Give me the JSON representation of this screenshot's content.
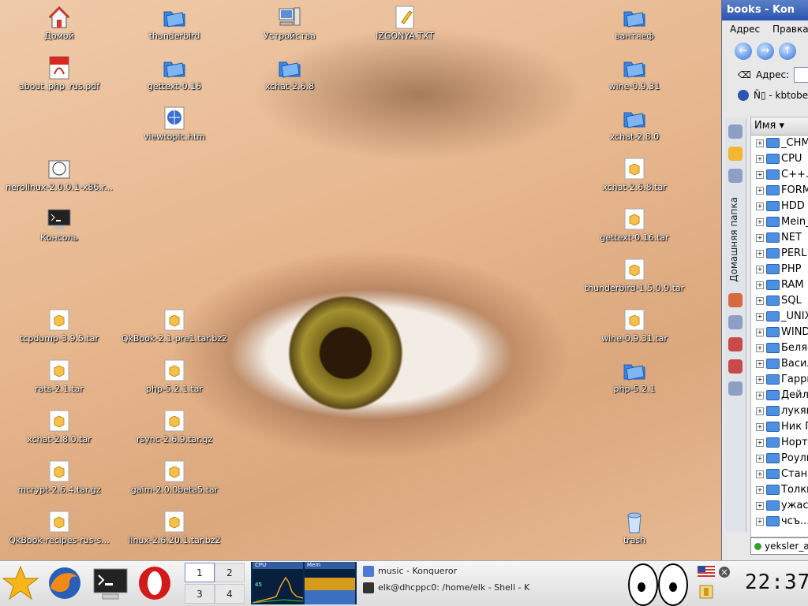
{
  "desktop": {
    "icons": [
      {
        "label": "Домой",
        "icon": "home-icon"
      },
      {
        "label": "thunderbird",
        "icon": "folder-icon"
      },
      {
        "label": "Устройства",
        "icon": "computer-icon"
      },
      {
        "label": "IZGONYA.TXT",
        "icon": "text-file-icon"
      },
      {
        "label": "вантяеф",
        "icon": "folder-icon"
      },
      {
        "label": "about_php_rus.pdf",
        "icon": "pdf-icon"
      },
      {
        "label": "gettext-0.16",
        "icon": "folder-icon"
      },
      {
        "label": "xchat-2.6.8",
        "icon": "folder-icon"
      },
      {
        "label": "wine-0.9.31",
        "icon": "folder-icon"
      },
      {
        "label": "viewtopic.htm",
        "icon": "html-file-icon"
      },
      {
        "label": "xchat-2.8.0",
        "icon": "folder-icon"
      },
      {
        "label": "nerolinux-2.0.0.1-x86.r...",
        "icon": "rpm-package-icon"
      },
      {
        "label": "xchat-2.6.8.tar",
        "icon": "archive-icon"
      },
      {
        "label": "Консоль",
        "icon": "terminal-icon"
      },
      {
        "label": "gettext-0.16.tar",
        "icon": "archive-icon"
      },
      {
        "label": "thunderbird-1.5.0.9.tar",
        "icon": "archive-icon"
      },
      {
        "label": "tcpdump-3.9.5.tar",
        "icon": "archive-icon"
      },
      {
        "label": "QkBook-2.1-pre1.tar.bz2",
        "icon": "archive-icon"
      },
      {
        "label": "wine-0.9.31.tar",
        "icon": "archive-icon"
      },
      {
        "label": "rats-2.1.tar",
        "icon": "archive-icon"
      },
      {
        "label": "php-5.2.1.tar",
        "icon": "archive-icon"
      },
      {
        "label": "php-5.2.1",
        "icon": "folder-icon"
      },
      {
        "label": "xchat-2.8.0.tar",
        "icon": "archive-icon"
      },
      {
        "label": "rsync-2.6.9.tar.gz",
        "icon": "archive-icon"
      },
      {
        "label": "mcrypt-2.6.4.tar.gz",
        "icon": "archive-icon"
      },
      {
        "label": "gaim-2.0.0beta5.tar",
        "icon": "archive-icon"
      },
      {
        "label": "QkBook-recipes-rus-s...",
        "icon": "archive-icon"
      },
      {
        "label": "linux-2.6.20.1.tar.bz2",
        "icon": "archive-icon"
      },
      {
        "label": "trash",
        "icon": "trash-icon"
      }
    ]
  },
  "konqueror": {
    "title": "books - Kon",
    "menu": [
      "Адрес",
      "Правка"
    ],
    "address_label": "Адрес:",
    "bookmark_label": "Ñ▯ - kbtobe",
    "sidebar_tab": "Домашняя папка",
    "column_header": "Имя",
    "folders": [
      "_CHM",
      "CPU",
      "C++.",
      "FORM",
      "HDD",
      "Mein_",
      "NET",
      "PERL",
      "PHP",
      "RAM",
      "SQL",
      "_UNIX",
      "WIND",
      "Беляе",
      "Васил",
      "Гарри",
      "Дейл",
      "лукян",
      "Ник П",
      "Нортс",
      "Роули",
      "Стани",
      "Толки",
      "ужас",
      "чсъ..."
    ],
    "status_text": "yeksler_a"
  },
  "taskbar": {
    "pager": [
      "1",
      "2",
      "3",
      "4"
    ],
    "active_desktop": "1",
    "sysmon": {
      "cpu_label": "CPU",
      "mem_label": "Mem",
      "scale": "45"
    },
    "tasks": [
      {
        "label": "music - Konqueror"
      },
      {
        "label": "elk@dhcppc0: /home/elk - Shell - K"
      }
    ],
    "clock": "22:37",
    "colors": {
      "accent": "#2b55b0",
      "panel": "#dcdcdc"
    }
  }
}
